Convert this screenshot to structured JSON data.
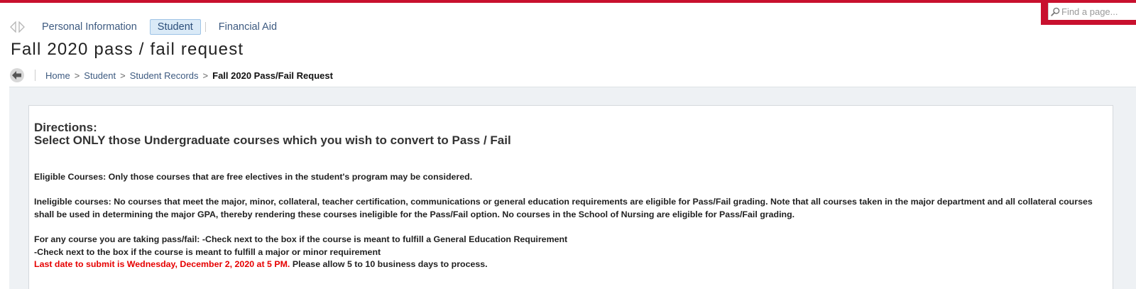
{
  "search": {
    "placeholder": "Find a page..."
  },
  "tabs": [
    {
      "label": "Personal Information",
      "active": false
    },
    {
      "label": "Student",
      "active": true
    },
    {
      "label": "Financial Aid",
      "active": false
    }
  ],
  "page": {
    "title": "Fall 2020 pass / fail request"
  },
  "breadcrumb": {
    "items": [
      "Home",
      "Student",
      "Student Records"
    ],
    "separator": ">",
    "current": "Fall 2020 Pass/Fail Request"
  },
  "directions": {
    "heading": "Directions:",
    "subheading": "Select ONLY those Undergraduate courses which you wish to convert to Pass / Fail",
    "eligible": "Eligible Courses: Only those courses that are free electives in the student's program may be considered.",
    "ineligible": "Ineligible courses: No courses that meet the major, minor, collateral, teacher certification, communications or general education requirements are eligible for Pass/Fail grading. Note that all courses taken in the major department and all collateral courses shall be used in determining the major GPA, thereby rendering these courses ineligible for the Pass/Fail option. No courses in the School of Nursing are eligible for Pass/Fail grading.",
    "instruction_1": "For any course you are taking pass/fail: -Check next to the box if the course is meant to fulfill a General Education Requirement",
    "instruction_2": "-Check next to the box if the course is meant to fulfill a major or minor requirement",
    "deadline": "Last date to submit is Wednesday, December 2, 2020 at 5 PM.",
    "processing": " Please allow 5 to 10 business days to process."
  },
  "colors": {
    "brand": "#c8102e",
    "link": "#3d5a80",
    "deadline": "#e60000"
  }
}
